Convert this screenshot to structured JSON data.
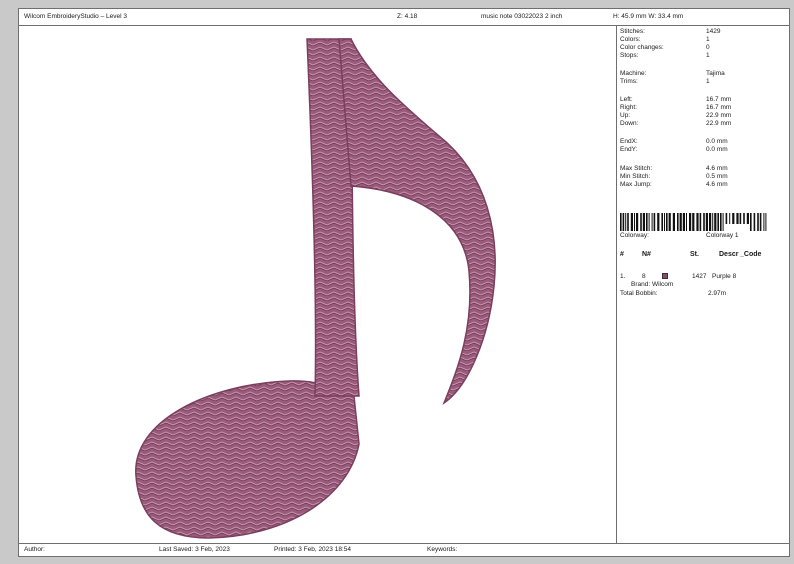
{
  "header": {
    "app_title": "Wilcom EmbroideryStudio – Level 3",
    "zoom": "Z: 4.18",
    "design_name": "music note 03022023 2 inch",
    "size": "H: 45.9 mm   W: 33.4 mm"
  },
  "stats": [
    {
      "label": "Stitches:",
      "value": "1429"
    },
    {
      "label": "Colors:",
      "value": "1"
    },
    {
      "label": "Color changes:",
      "value": "0"
    },
    {
      "label": "Stops:",
      "value": "1"
    },
    {
      "label": "Machine:",
      "value": "Tajima"
    },
    {
      "label": "Trims:",
      "value": "1"
    },
    {
      "label": "Left:",
      "value": "16.7 mm"
    },
    {
      "label": "Right:",
      "value": "16.7 mm"
    },
    {
      "label": "Up:",
      "value": "22.9 mm"
    },
    {
      "label": "Down:",
      "value": "22.9 mm"
    },
    {
      "label": "EndX:",
      "value": "0.0 mm"
    },
    {
      "label": "EndY:",
      "value": "0.0 mm"
    },
    {
      "label": "Max Stitch:",
      "value": "4.6 mm"
    },
    {
      "label": "Min Stitch:",
      "value": "0.5 mm"
    },
    {
      "label": "Max Jump:",
      "value": "4.6 mm"
    }
  ],
  "colorway": {
    "label": "Colorway:",
    "value": "Colorway 1"
  },
  "thread_table": {
    "headers": {
      "num": "#",
      "n": "N#",
      "st": "St.",
      "descr": "Descr",
      "code": "_Code"
    },
    "rows": [
      {
        "num": "1.",
        "n": "8",
        "swatch_color": "#8a4a6c",
        "st": "1427",
        "descr": "Purple 8",
        "brand": "Brand: Wilcom"
      }
    ],
    "total_bobbin_label": "Total Bobbin:",
    "total_bobbin_value": "2.97m"
  },
  "footer": {
    "author": "Author:",
    "last_saved": "Last Saved:   3 Feb, 2023",
    "printed": "Printed:   3 Feb, 2023 18:54",
    "keywords": "Keywords:"
  },
  "colors": {
    "stitch_fill": "#9a5a7a",
    "stitch_dark": "#6e3553",
    "stitch_light": "#c99ab2"
  }
}
